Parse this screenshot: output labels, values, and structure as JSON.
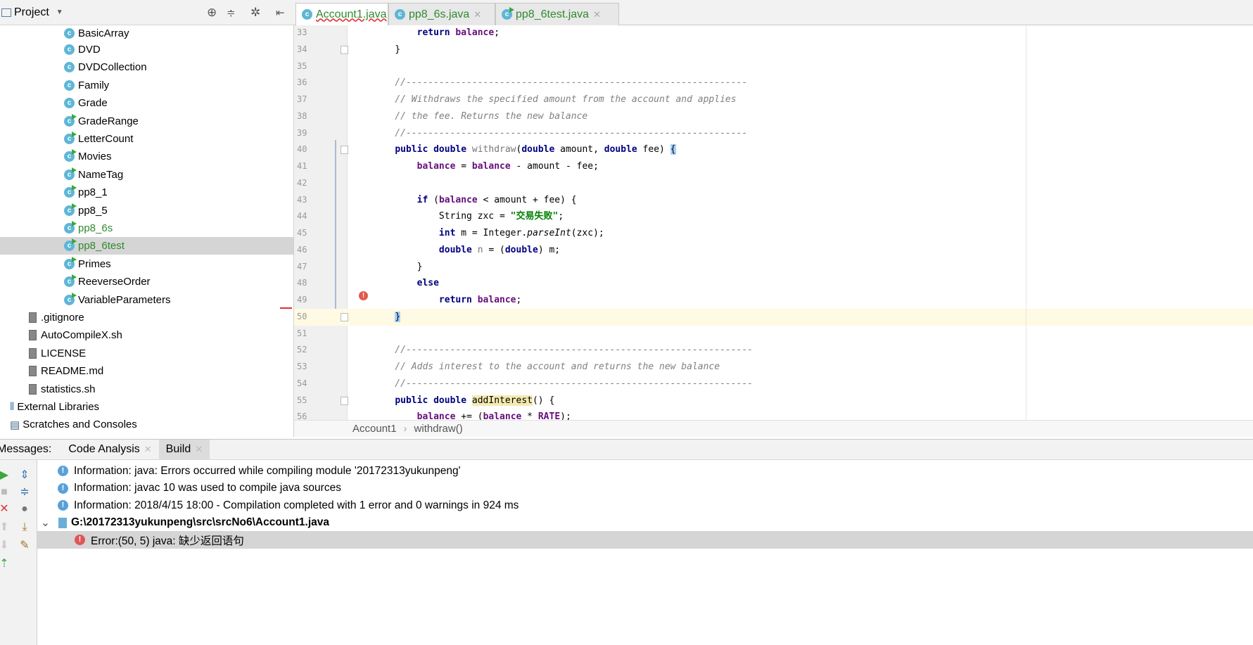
{
  "sidebar": {
    "title": "Project",
    "partial_item": "BasicArray",
    "items": [
      {
        "label": "DVD",
        "type": "class",
        "run": false,
        "green": false
      },
      {
        "label": "DVDCollection",
        "type": "class",
        "run": false,
        "green": false
      },
      {
        "label": "Family",
        "type": "class",
        "run": false,
        "green": false
      },
      {
        "label": "Grade",
        "type": "class",
        "run": false,
        "green": false
      },
      {
        "label": "GradeRange",
        "type": "class",
        "run": true,
        "green": false
      },
      {
        "label": "LetterCount",
        "type": "class",
        "run": true,
        "green": false
      },
      {
        "label": "Movies",
        "type": "class",
        "run": true,
        "green": false
      },
      {
        "label": "NameTag",
        "type": "class",
        "run": true,
        "green": false
      },
      {
        "label": "pp8_1",
        "type": "class",
        "run": true,
        "green": false
      },
      {
        "label": "pp8_5",
        "type": "class",
        "run": true,
        "green": false
      },
      {
        "label": "pp8_6s",
        "type": "class",
        "run": true,
        "green": true
      },
      {
        "label": "pp8_6test",
        "type": "class",
        "run": true,
        "green": true,
        "selected": true
      },
      {
        "label": "Primes",
        "type": "class",
        "run": true,
        "green": false
      },
      {
        "label": "ReeverseOrder",
        "type": "class",
        "run": true,
        "green": false
      },
      {
        "label": "VariableParameters",
        "type": "class",
        "run": true,
        "green": false
      },
      {
        "label": ".gitignore",
        "type": "file"
      },
      {
        "label": "AutoCompileX.sh",
        "type": "file"
      },
      {
        "label": "LICENSE",
        "type": "file"
      },
      {
        "label": "README.md",
        "type": "file"
      },
      {
        "label": "statistics.sh",
        "type": "file"
      },
      {
        "label": "External Libraries",
        "type": "libs"
      },
      {
        "label": "Scratches and Consoles",
        "type": "scratch"
      }
    ]
  },
  "tabs": [
    {
      "label": "Account1.java",
      "active": true
    },
    {
      "label": "pp8_6s.java",
      "active": false
    },
    {
      "label": "pp8_6test.java",
      "active": false
    }
  ],
  "editor": {
    "current_line": 50,
    "lines": [
      {
        "n": "33",
        "t": [
          [
            "        ",
            ""
          ],
          [
            "return",
            "kw"
          ],
          [
            " ",
            ""
          ],
          [
            "balance",
            "fld"
          ],
          [
            ";",
            ""
          ]
        ]
      },
      {
        "n": "34",
        "t": [
          [
            "    }",
            ""
          ]
        ]
      },
      {
        "n": "35",
        "t": []
      },
      {
        "n": "36",
        "t": [
          [
            "    //--------------------------------------------------------------",
            "cm"
          ]
        ]
      },
      {
        "n": "37",
        "t": [
          [
            "    // Withdraws the specified amount from the account and applies",
            "cm"
          ]
        ]
      },
      {
        "n": "38",
        "t": [
          [
            "    // the fee. Returns the new balance",
            "cm"
          ]
        ]
      },
      {
        "n": "39",
        "t": [
          [
            "    //--------------------------------------------------------------",
            "cm"
          ]
        ]
      },
      {
        "n": "40",
        "t": [
          [
            "    ",
            ""
          ],
          [
            "public double ",
            "kw"
          ],
          [
            "withdraw",
            "dim"
          ],
          [
            "(",
            ""
          ],
          [
            "double",
            "kw"
          ],
          [
            " amount, ",
            ""
          ],
          [
            "double",
            "kw"
          ],
          [
            " fee) ",
            ""
          ],
          [
            "{",
            "br"
          ]
        ]
      },
      {
        "n": "41",
        "t": [
          [
            "        ",
            ""
          ],
          [
            "balance",
            "fld"
          ],
          [
            " = ",
            ""
          ],
          [
            "balance",
            "fld"
          ],
          [
            " - amount - fee;",
            ""
          ]
        ]
      },
      {
        "n": "42",
        "t": []
      },
      {
        "n": "43",
        "t": [
          [
            "        ",
            ""
          ],
          [
            "if",
            "kw"
          ],
          [
            " (",
            ""
          ],
          [
            "balance",
            "fld"
          ],
          [
            " < amount + fee) {",
            ""
          ]
        ]
      },
      {
        "n": "44",
        "t": [
          [
            "            String zxc = ",
            ""
          ],
          [
            "\"交易失败\"",
            "str"
          ],
          [
            ";",
            ""
          ]
        ]
      },
      {
        "n": "45",
        "t": [
          [
            "            ",
            ""
          ],
          [
            "int",
            "kw"
          ],
          [
            " m = Integer.",
            ""
          ],
          [
            "parseInt",
            "it"
          ],
          [
            "(zxc);",
            ""
          ]
        ]
      },
      {
        "n": "46",
        "t": [
          [
            "            ",
            ""
          ],
          [
            "double",
            "kw"
          ],
          [
            " ",
            ""
          ],
          [
            "n",
            "dim"
          ],
          [
            " = (",
            ""
          ],
          [
            "double",
            "kw"
          ],
          [
            ") m;",
            ""
          ]
        ]
      },
      {
        "n": "47",
        "t": [
          [
            "        }",
            ""
          ]
        ]
      },
      {
        "n": "48",
        "t": [
          [
            "        ",
            ""
          ],
          [
            "else",
            "kw"
          ]
        ]
      },
      {
        "n": "49",
        "t": [
          [
            "            ",
            ""
          ],
          [
            "return",
            "kw"
          ],
          [
            " ",
            ""
          ],
          [
            "balance",
            "fld"
          ],
          [
            ";",
            ""
          ]
        ]
      },
      {
        "n": "50",
        "t": [
          [
            "    ",
            ""
          ],
          [
            "}",
            "br"
          ]
        ]
      },
      {
        "n": "51",
        "t": []
      },
      {
        "n": "52",
        "t": [
          [
            "    //---------------------------------------------------------------",
            "cm"
          ]
        ]
      },
      {
        "n": "53",
        "t": [
          [
            "    // Adds interest to the account and returns the new balance",
            "cm"
          ]
        ]
      },
      {
        "n": "54",
        "t": [
          [
            "    //---------------------------------------------------------------",
            "cm"
          ]
        ]
      },
      {
        "n": "55",
        "t": [
          [
            "    ",
            ""
          ],
          [
            "public double ",
            "kw"
          ],
          [
            "addInterest",
            "hl"
          ],
          [
            "() {",
            ""
          ]
        ]
      },
      {
        "n": "56",
        "t": [
          [
            "        ",
            ""
          ],
          [
            "balance",
            "fld"
          ],
          [
            " += (",
            ""
          ],
          [
            "balance",
            "fld"
          ],
          [
            " * ",
            ""
          ],
          [
            "RATE",
            "fld"
          ],
          [
            ");",
            ""
          ]
        ]
      }
    ]
  },
  "breadcrumb": {
    "class": "Account1",
    "method": "withdraw()"
  },
  "panel": {
    "label": "Messages:",
    "tabs": [
      {
        "label": "Code Analysis",
        "active": false
      },
      {
        "label": "Build",
        "active": true
      }
    ],
    "messages": [
      {
        "kind": "info",
        "text": "Information: java: Errors occurred while compiling module '20172313yukunpeng'"
      },
      {
        "kind": "info",
        "text": "Information: javac 10 was used to compile java sources"
      },
      {
        "kind": "info",
        "text": "Information: 2018/4/15 18:00 - Compilation completed with 1 error and 0 warnings in 924 ms"
      },
      {
        "kind": "file",
        "text": "G:\\20172313yukunpeng\\src\\srcNo6\\Account1.java"
      },
      {
        "kind": "error",
        "text": "Error:(50, 5)  java: 缺少返回语句"
      }
    ]
  },
  "colors": {
    "keyword": "#000080",
    "field": "#660e7a",
    "string": "#008000",
    "comment": "#808080",
    "selection": "#d5d5d5",
    "current_line": "#fffae3"
  }
}
